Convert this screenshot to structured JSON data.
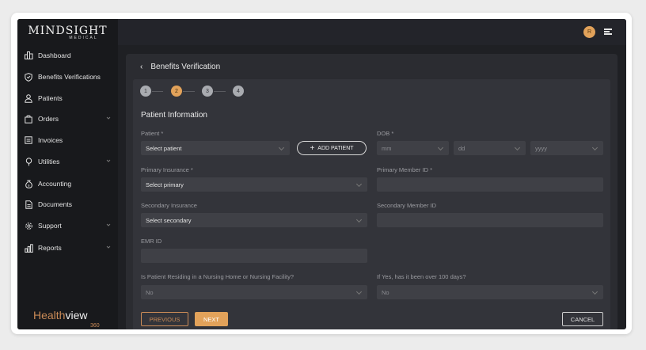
{
  "brand": {
    "logo": "MINDSIGHT",
    "logo_sub": "MEDICAL"
  },
  "user": {
    "avatar_initial": "R"
  },
  "sidebar": {
    "items": [
      {
        "label": "Dashboard",
        "icon": "bar-chart-icon"
      },
      {
        "label": "Benefits Verifications",
        "icon": "shield-icon"
      },
      {
        "label": "Patients",
        "icon": "user-icon"
      },
      {
        "label": "Orders",
        "icon": "bag-icon",
        "has_chevron": true
      },
      {
        "label": "Invoices",
        "icon": "invoice-icon"
      },
      {
        "label": "Utilities",
        "icon": "lightbulb-icon",
        "has_chevron": true
      },
      {
        "label": "Accounting",
        "icon": "money-bag-icon"
      },
      {
        "label": "Documents",
        "icon": "document-icon"
      },
      {
        "label": "Support",
        "icon": "gear-icon",
        "has_chevron": true
      },
      {
        "label": "Reports",
        "icon": "report-icon",
        "has_chevron": true
      }
    ],
    "footer_brand": {
      "health": "Health",
      "view": "view",
      "num": "360"
    }
  },
  "page": {
    "title": "Benefits Verification",
    "steps": [
      "1",
      "2",
      "3",
      "4"
    ],
    "active_step": 2,
    "section_title": "Patient Information",
    "fields": {
      "patient_label": "Patient *",
      "patient_value": "Select patient",
      "add_patient": "ADD PATIENT",
      "dob_label": "DOB *",
      "dob_mm": "mm",
      "dob_dd": "dd",
      "dob_yyyy": "yyyy",
      "primary_ins_label": "Primary Insurance *",
      "primary_ins_value": "Select primary",
      "primary_member_label": "Primary Member ID *",
      "secondary_ins_label": "Secondary Insurance",
      "secondary_ins_value": "Select secondary",
      "secondary_member_label": "Secondary Member ID",
      "emr_label": "EMR ID",
      "nursing_label": "Is Patient Residing in a Nursing Home or Nursing Facility?",
      "nursing_value": "No",
      "days_label": "If Yes, has it been over 100 days?",
      "days_value": "No"
    },
    "buttons": {
      "previous": "PREVIOUS",
      "next": "NEXT",
      "cancel": "CANCEL"
    }
  },
  "colors": {
    "accent": "#e2a25a",
    "background": "#1f2024",
    "panel": "#2b2c31"
  }
}
